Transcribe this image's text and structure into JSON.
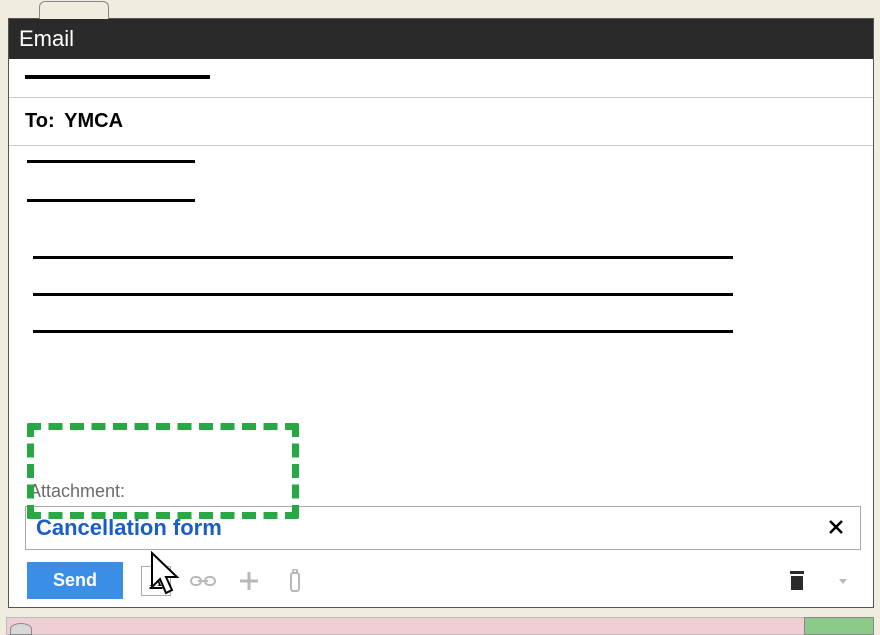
{
  "window": {
    "title": "Email"
  },
  "fields": {
    "to_label": "To:",
    "to_value": "YMCA",
    "attachment_label": "Attachment:",
    "attachment_name": "Cancellation form"
  },
  "toolbar": {
    "send_label": "Send",
    "format_glyph": "A"
  }
}
